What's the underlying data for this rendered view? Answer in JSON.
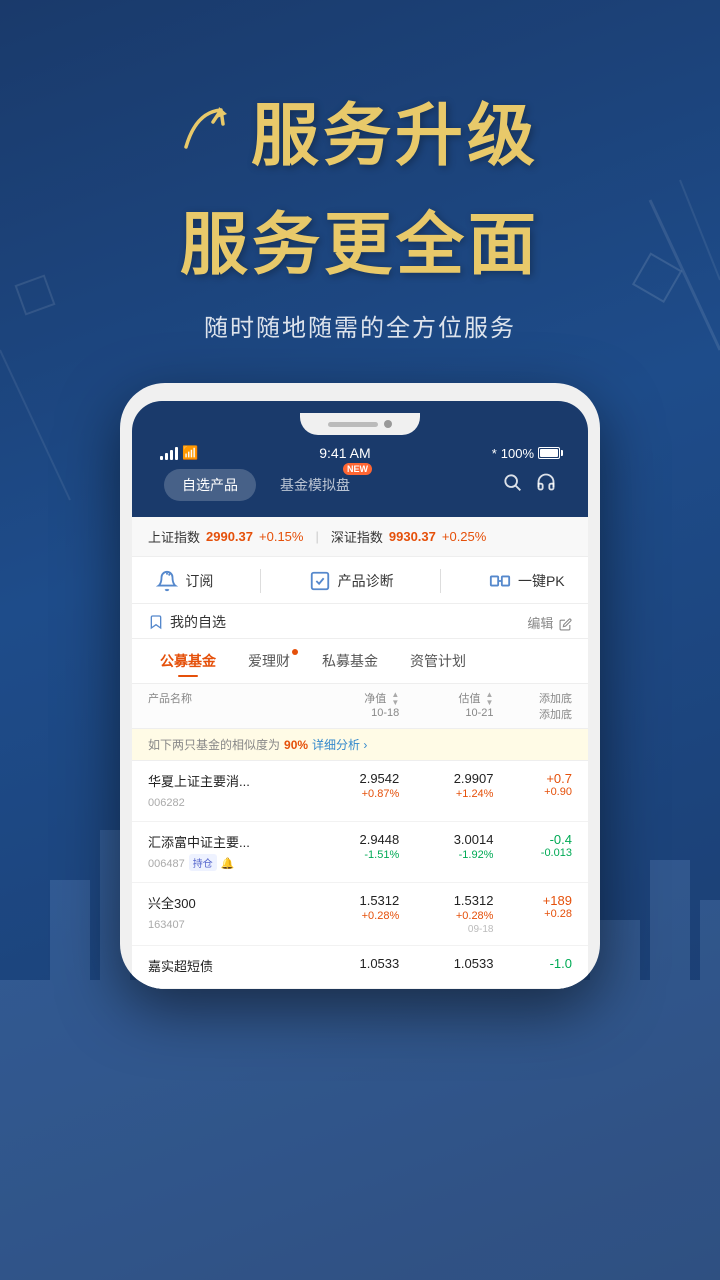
{
  "background": {
    "gradient_start": "#1a3a6b",
    "gradient_end": "#1e4c8a"
  },
  "hero": {
    "arrow_icon_unicode": "↗",
    "title_row1": "服务升级",
    "title_row2": "服务更全面",
    "subtitle": "随时随地随需的全方位服务"
  },
  "phone": {
    "status_bar": {
      "time": "9:41 AM",
      "battery_pct": "100%",
      "bluetooth_on": true
    },
    "tabs": {
      "tab1": "自选产品",
      "tab2": "基金模拟盘",
      "tab2_badge": "NEW",
      "search_icon": "search",
      "headset_icon": "headset"
    },
    "index_ticker": {
      "index1_name": "上证指数",
      "index1_value": "2990.37",
      "index1_change": "+0.15%",
      "index2_name": "深证指数",
      "index2_value": "9930.37",
      "index2_change": "+0.25%"
    },
    "function_bar": {
      "item1_icon": "bell",
      "item1_label": "订阅",
      "item2_icon": "chart",
      "item2_label": "产品诊断",
      "item3_icon": "vs",
      "item3_label": "一键PK"
    },
    "watchlist": {
      "title": "我的自选",
      "title_icon": "bookmark",
      "edit_label": "编辑",
      "edit_icon": "edit"
    },
    "category_tabs": [
      {
        "label": "公募基金",
        "active": true,
        "dot": false
      },
      {
        "label": "爱理财",
        "active": false,
        "dot": true
      },
      {
        "label": "私募基金",
        "active": false,
        "dot": false
      },
      {
        "label": "资管计划",
        "active": false,
        "dot": false
      }
    ],
    "table_header": {
      "col_name": "产品名称",
      "col_nav": "净值",
      "col_nav_date": "10-18",
      "col_est": "估值",
      "col_est_date": "10-21",
      "col_add": "添加底",
      "col_add2": "添加底"
    },
    "similarity_alert": {
      "text_pre": "如下两只基金的相似度为",
      "pct": "90%",
      "link_text": "详细分析 ›"
    },
    "funds": [
      {
        "name": "华夏上证主要消...",
        "code": "006282",
        "nav": "2.9542",
        "nav_chg": "+0.87%",
        "nav_chg_pos": true,
        "est": "2.9907",
        "est_chg": "+1.24%",
        "est_chg_pos": true,
        "add_val": "+0.7",
        "add_sub": "+0.90",
        "add_pos": true,
        "tag": null,
        "bell": false,
        "date": null
      },
      {
        "name": "汇添富中证主要...",
        "code": "006487",
        "nav": "2.9448",
        "nav_chg": "-1.51%",
        "nav_chg_pos": false,
        "est": "3.0014",
        "est_chg": "-1.92%",
        "est_chg_pos": false,
        "add_val": "-0.4",
        "add_sub": "-0.013",
        "add_pos": false,
        "tag": "持仓",
        "bell": true,
        "date": null
      },
      {
        "name": "兴全300",
        "code": "163407",
        "nav": "1.5312",
        "nav_chg": "+0.28%",
        "nav_chg_pos": true,
        "est": "1.5312",
        "est_chg": "+0.28%",
        "est_chg_pos": true,
        "add_val": "+189",
        "add_sub": "+0.28",
        "add_pos": true,
        "tag": null,
        "bell": false,
        "date": "09-18"
      },
      {
        "name": "嘉实超短债",
        "code": "",
        "nav": "1.0533",
        "nav_chg": "",
        "nav_chg_pos": true,
        "est": "1.0533",
        "est_chg": "",
        "est_chg_pos": true,
        "add_val": "-1.0",
        "add_sub": "",
        "add_pos": false,
        "tag": null,
        "bell": false,
        "date": null
      }
    ]
  }
}
